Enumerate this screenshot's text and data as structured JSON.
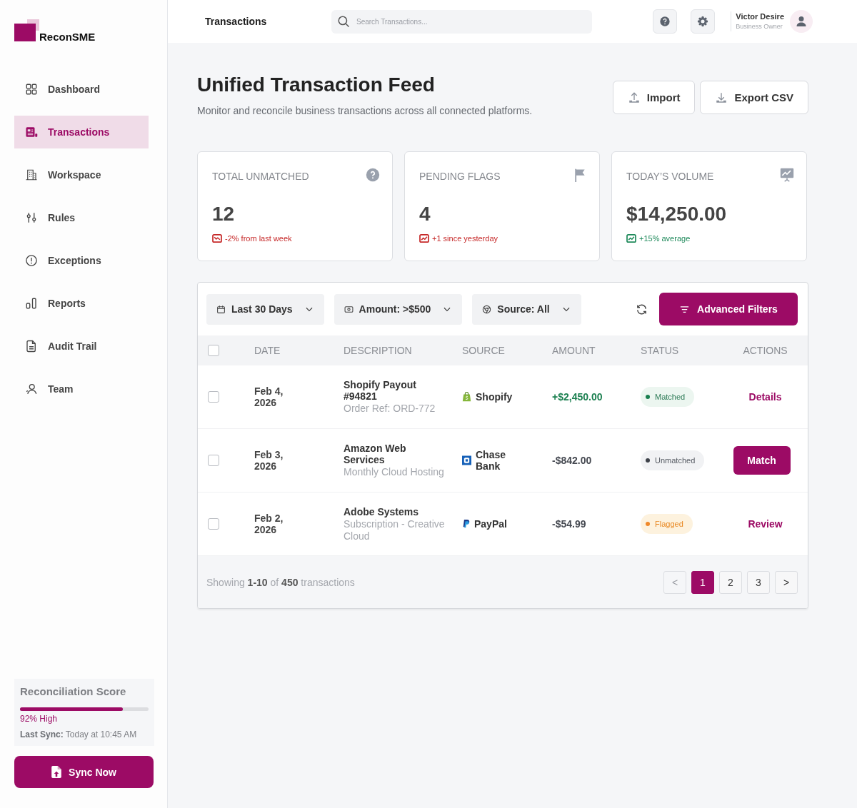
{
  "sidebar": {
    "logo": "ReconSME",
    "items": [
      {
        "label": "Dashboard",
        "selected": false
      },
      {
        "label": "Transactions",
        "selected": true
      },
      {
        "label": "Workspace",
        "selected": false
      },
      {
        "label": "Rules",
        "selected": false
      },
      {
        "label": "Exceptions",
        "selected": false
      },
      {
        "label": "Reports",
        "selected": false
      },
      {
        "label": "Audit Trail",
        "selected": false
      },
      {
        "label": "Team",
        "selected": false
      }
    ],
    "score": {
      "title": "Reconciliation Score",
      "level": 0.8,
      "reading": "92% High",
      "last_sync": "**Last Sync:** Today at 10:45 AM"
    },
    "sync_button": "Sync Now"
  },
  "header": {
    "title": "Transactions",
    "search": {
      "placeholder": "Search Transactions..."
    },
    "user": {
      "name": "Victor Desire",
      "role": "Business Owner"
    }
  },
  "page": {
    "title": "Unified Transaction Feed",
    "subtitle": "Monitor and reconcile business transactions across all connected platforms.",
    "buttons": [
      "Import",
      "Export CSV"
    ]
  },
  "stats": [
    {
      "label": "TOTAL UNMATCHED",
      "value": "12",
      "trend": {
        "text": "-2% from last week",
        "kind": "down",
        "color": "#c62828"
      }
    },
    {
      "label": "PENDING FLAGS",
      "value": "4",
      "trend": {
        "text": "+1 since yesterday",
        "kind": "up",
        "color": "#c62828"
      }
    },
    {
      "label": "TODAY’S VOLUME",
      "value": "$14,250.00",
      "trend": {
        "text": "+15% average",
        "kind": "up",
        "color": "#1f8a5b"
      }
    }
  ],
  "filters": {
    "items": [
      "Last 30 Days",
      "Amount: >$500",
      "Source: All"
    ],
    "advanced_button": "Advanced Filters"
  },
  "table": {
    "header_checked": false,
    "columns": [
      "DATE",
      "DESCRIPTION",
      "SOURCE",
      "AMOUNT",
      "STATUS",
      "ACTIONS"
    ],
    "rows": [
      {
        "checked": false,
        "date": "Feb 4, 2026",
        "description": "Shopify Payout #94821",
        "detail": "Order Ref: ORD-772",
        "source": "Shopify",
        "amount": {
          "text": "+$2,450.00",
          "kind": "credit"
        },
        "status": {
          "label": "Matched",
          "kind": "matched",
          "color": "#1a7f4f"
        },
        "action": {
          "label": "Details",
          "kind": "link"
        }
      },
      {
        "checked": false,
        "date": "Feb 3, 2026",
        "description": "Amazon Web Services",
        "detail": "Monthly Cloud Hosting",
        "source": "Chase Bank",
        "amount": {
          "text": "-$842.00",
          "kind": "debit"
        },
        "status": {
          "label": "Unmatched",
          "kind": "unmatched",
          "color": "#3d4149"
        },
        "action": {
          "label": "Match",
          "kind": "button"
        }
      },
      {
        "checked": false,
        "date": "Feb 2, 2026",
        "description": "Adobe Systems",
        "detail": "Subscription - Creative Cloud",
        "source": "PayPal",
        "amount": {
          "text": "-$54.99",
          "kind": "debit"
        },
        "status": {
          "label": "Flagged",
          "kind": "flagged",
          "color": "#f0892a"
        },
        "action": {
          "label": "Review",
          "kind": "link"
        }
      }
    ]
  },
  "footer": {
    "summary": "Showing **1-10** of **450** transactions",
    "pagination": {
      "prev": {
        "label": "<",
        "disabled": true
      },
      "pages": [
        {
          "label": "1",
          "selected": true
        },
        {
          "label": "2",
          "selected": false
        },
        {
          "label": "3",
          "selected": false
        }
      ],
      "next": {
        "label": ">",
        "disabled": false
      }
    }
  }
}
